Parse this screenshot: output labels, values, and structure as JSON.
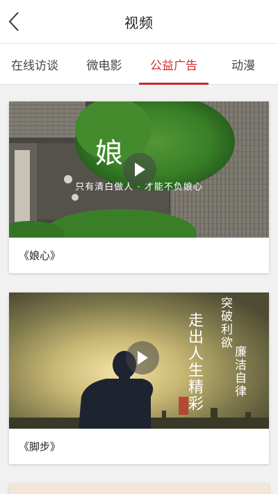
{
  "header": {
    "title": "视频"
  },
  "tabs": [
    {
      "label": "在线访谈",
      "active": false
    },
    {
      "label": "微电影",
      "active": false
    },
    {
      "label": "公益广告",
      "active": true
    },
    {
      "label": "动漫",
      "active": false
    }
  ],
  "videos": [
    {
      "caption": "《娘心》",
      "overlay_char": "娘",
      "overlay_line": "只有清白做人 · 才能不负娘心"
    },
    {
      "caption": "《脚步》",
      "overlay_col1": "突破利欲",
      "overlay_col2": "廉洁自律",
      "overlay_calligraphy": "走出人生精彩"
    }
  ],
  "colors": {
    "accent": "#c8262d",
    "background": "#f1f1f1"
  }
}
